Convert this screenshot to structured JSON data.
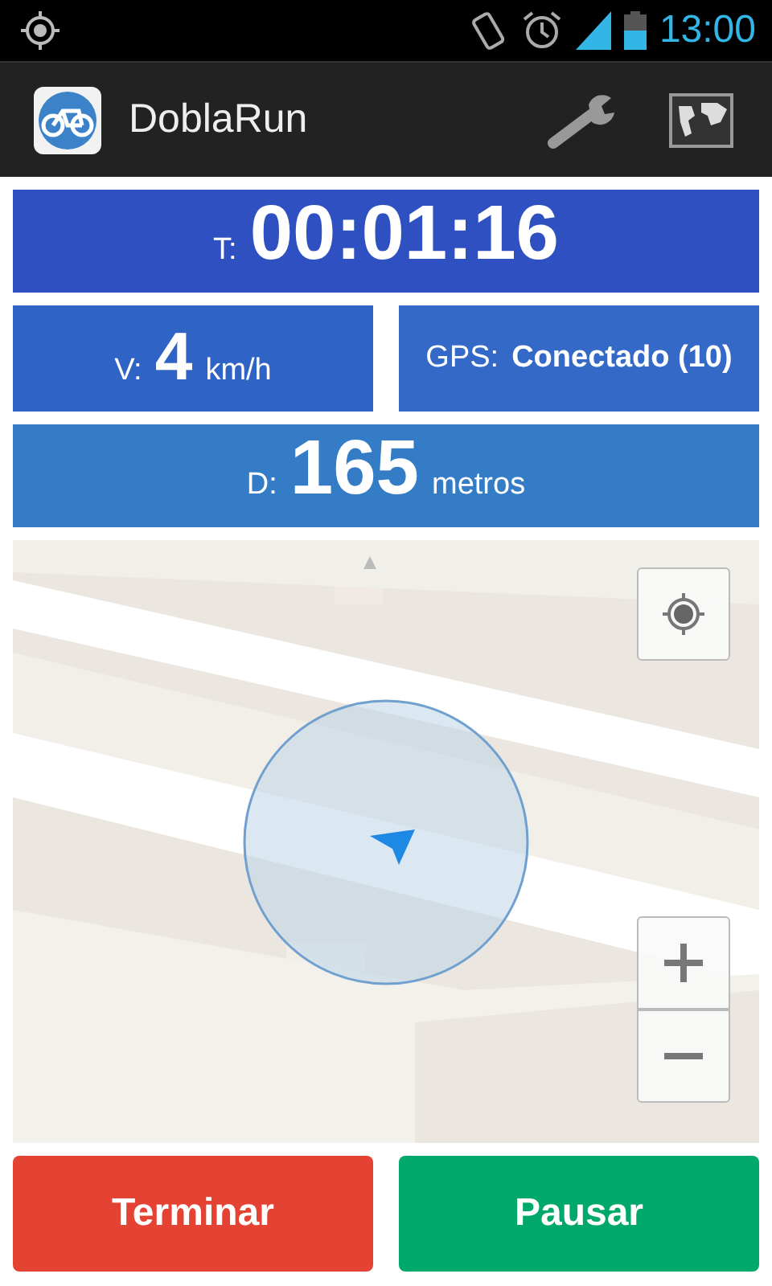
{
  "status_bar": {
    "time": "13:00"
  },
  "app_bar": {
    "title": "DoblaRun"
  },
  "timer": {
    "label": "T:",
    "value": "00:01:16"
  },
  "speed": {
    "label": "V:",
    "value": "4",
    "unit": "km/h"
  },
  "gps": {
    "label": "GPS:",
    "value": "Conectado (10)"
  },
  "distance": {
    "label": "D:",
    "value": "165",
    "unit": "metros"
  },
  "buttons": [
    {
      "label": "Terminar",
      "kind": "stop"
    },
    {
      "label": "Pausar",
      "kind": "pause"
    }
  ]
}
